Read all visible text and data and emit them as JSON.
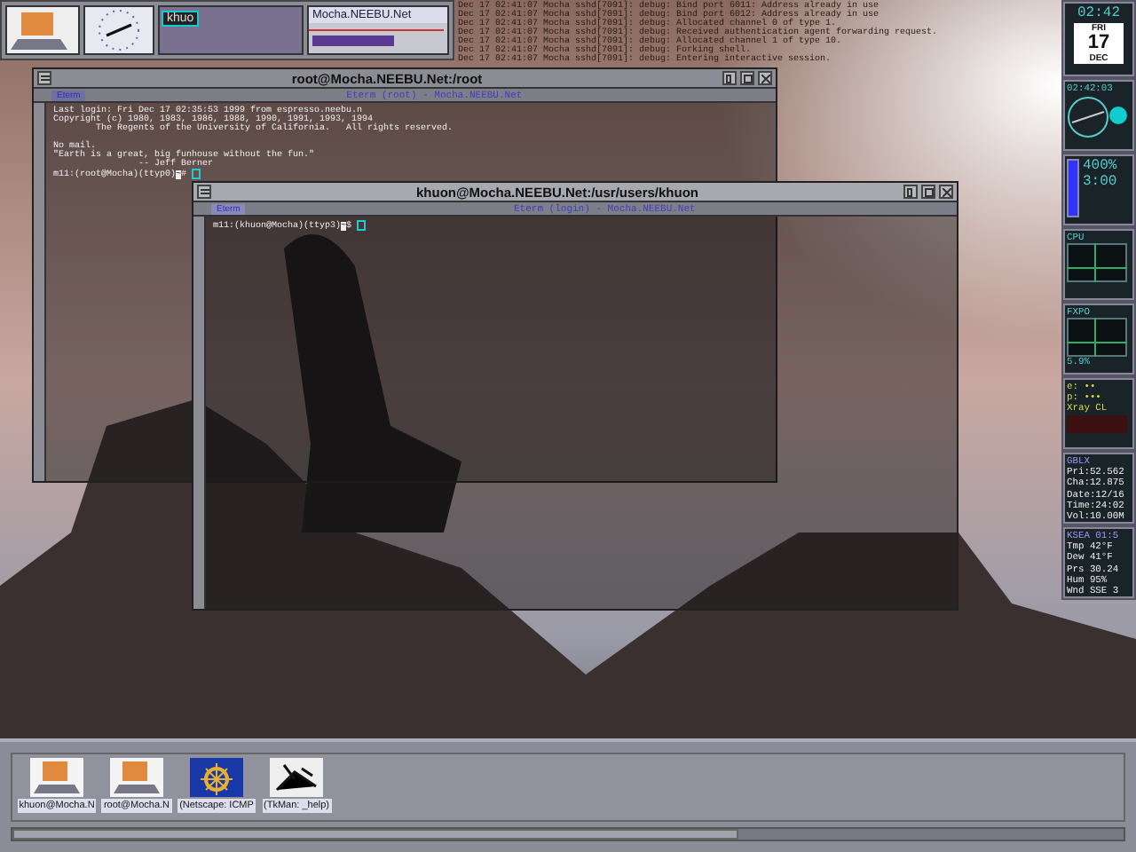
{
  "pager": {
    "mini_window": "khuo",
    "monitor_title": "Mocha.NEEBU.Net"
  },
  "log_lines": [
    "Dec 17 02:41:07 Mocha sshd[7091]: debug: Bind port 6011: Address already in use",
    "Dec 17 02:41:07 Mocha sshd[7091]: debug: Bind port 6012: Address already in use",
    "Dec 17 02:41:07 Mocha sshd[7091]: debug: Allocated channel 0 of type 1.",
    "Dec 17 02:41:07 Mocha sshd[7091]: debug: Received authentication agent forwarding request.",
    "Dec 17 02:41:07 Mocha sshd[7091]: debug: Allocated channel 1 of type 10.",
    "Dec 17 02:41:07 Mocha sshd[7091]: debug: Forking shell.",
    "Dec 17 02:41:07 Mocha sshd[7091]: debug: Entering interactive session."
  ],
  "windows": [
    {
      "title": "root@Mocha.NEEBU.Net:/root",
      "tab": "Eterm",
      "subtitle": "Eterm (root) - Mocha.NEEBU.Net",
      "active": false,
      "lines": [
        "Last login: Fri Dec 17 02:35:53 1999 from espresso.neebu.n",
        "Copyright (c) 1980, 1983, 1986, 1988, 1990, 1991, 1993, 1994",
        "        The Regents of the University of California.   All rights reserved.",
        "No mail.",
        "\"Earth is a great, big funhouse without the fun.\"",
        "                -- Jeff Berner"
      ],
      "prompt": "m11:(root@Mocha)(ttyp0)",
      "directory": "~",
      "symbol": "#"
    },
    {
      "title": "khuon@Mocha.NEEBU.Net:/usr/users/khuon",
      "tab": "Eterm",
      "subtitle": "Eterm (login) - Mocha.NEEBU.Net",
      "active": true,
      "prompt": "m11:(khuon@Mocha)(ttyp3)",
      "directory": "~",
      "symbol": "$"
    }
  ],
  "dock": [
    {
      "kind": "clock",
      "lines": [
        "02:42",
        "FRI",
        "17",
        "DEC"
      ]
    },
    {
      "kind": "gauge",
      "lines": [
        "02:42:03"
      ]
    },
    {
      "kind": "battery",
      "lines": [
        "400%",
        "3:00"
      ]
    },
    {
      "kind": "graph",
      "lines": [
        "CPU"
      ]
    },
    {
      "kind": "graph",
      "lines": [
        "FXPO",
        "5.9%"
      ]
    },
    {
      "kind": "mail",
      "lines": [
        "e: ••",
        "p: •••",
        "Xray CL"
      ]
    },
    {
      "kind": "readout",
      "lines": [
        "GBLX",
        "Pri:52.562",
        "Cha:12.875",
        "Date:12/16",
        "Time:24:02",
        "Vol:10.00M"
      ]
    },
    {
      "kind": "readout",
      "lines": [
        "KSEA 01:5",
        "Tmp 42°F",
        "Dew 41°F",
        "Prs 30.24",
        "Hum 95%",
        "Wnd SSE 3"
      ]
    }
  ],
  "taskbar": [
    {
      "kind": "laptop",
      "label": "khuon@Mocha.N"
    },
    {
      "kind": "laptop",
      "label": "root@Mocha.N"
    },
    {
      "kind": "wheel",
      "label": "(Netscape: ICMP"
    },
    {
      "kind": "drawing",
      "label": "(TkMan: _help)"
    }
  ]
}
